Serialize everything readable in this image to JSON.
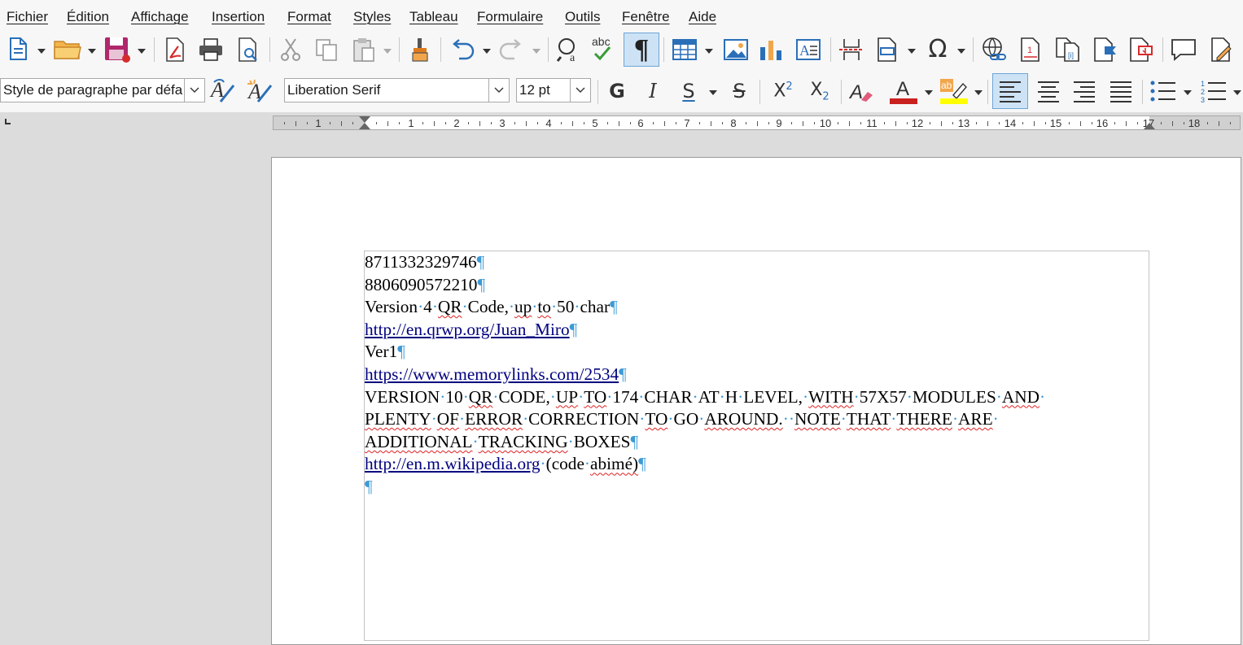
{
  "menu": [
    "Fichier",
    "Édition",
    "Affichage",
    "Insertion",
    "Format",
    "Styles",
    "Tableau",
    "Formulaire",
    "Outils",
    "Fenêtre",
    "Aide"
  ],
  "formatting": {
    "paragraph_style": "Style de paragraphe par défa",
    "font_name": "Liberation Serif",
    "font_size": "12 pt",
    "bold_label": "G",
    "italic_label": "I",
    "underline_label": "S",
    "strike_label": "S"
  },
  "ruler": {
    "left_labels": [
      "1"
    ],
    "labels": [
      "1",
      "2",
      "3",
      "4",
      "5",
      "6",
      "7",
      "8",
      "9",
      "10",
      "11",
      "12",
      "13",
      "14",
      "15",
      "16",
      "17",
      "18"
    ]
  },
  "document": {
    "lines": [
      "8711332329746",
      "8806090572210",
      "Version 4 QR Code, up to 50 char",
      "http://en.qrwp.org/Juan_Miro",
      "Ver1",
      "https://www.memorylinks.com/2534",
      "VERSION 10 QR CODE, UP TO 174 CHAR AT H LEVEL, WITH 57X57 MODULES AND",
      "PLENTY OF ERROR CORRECTION TO GO AROUND.  NOTE THAT THERE ARE",
      "ADDITIONAL TRACKING BOXES",
      "http://en.m.wikipedia.org (code abimé)"
    ]
  },
  "colors": {
    "font_color": "#c9211e",
    "highlight_color": "#ffff00",
    "link_color": "#000080",
    "formatting_mark_color": "#3c9ad6"
  }
}
